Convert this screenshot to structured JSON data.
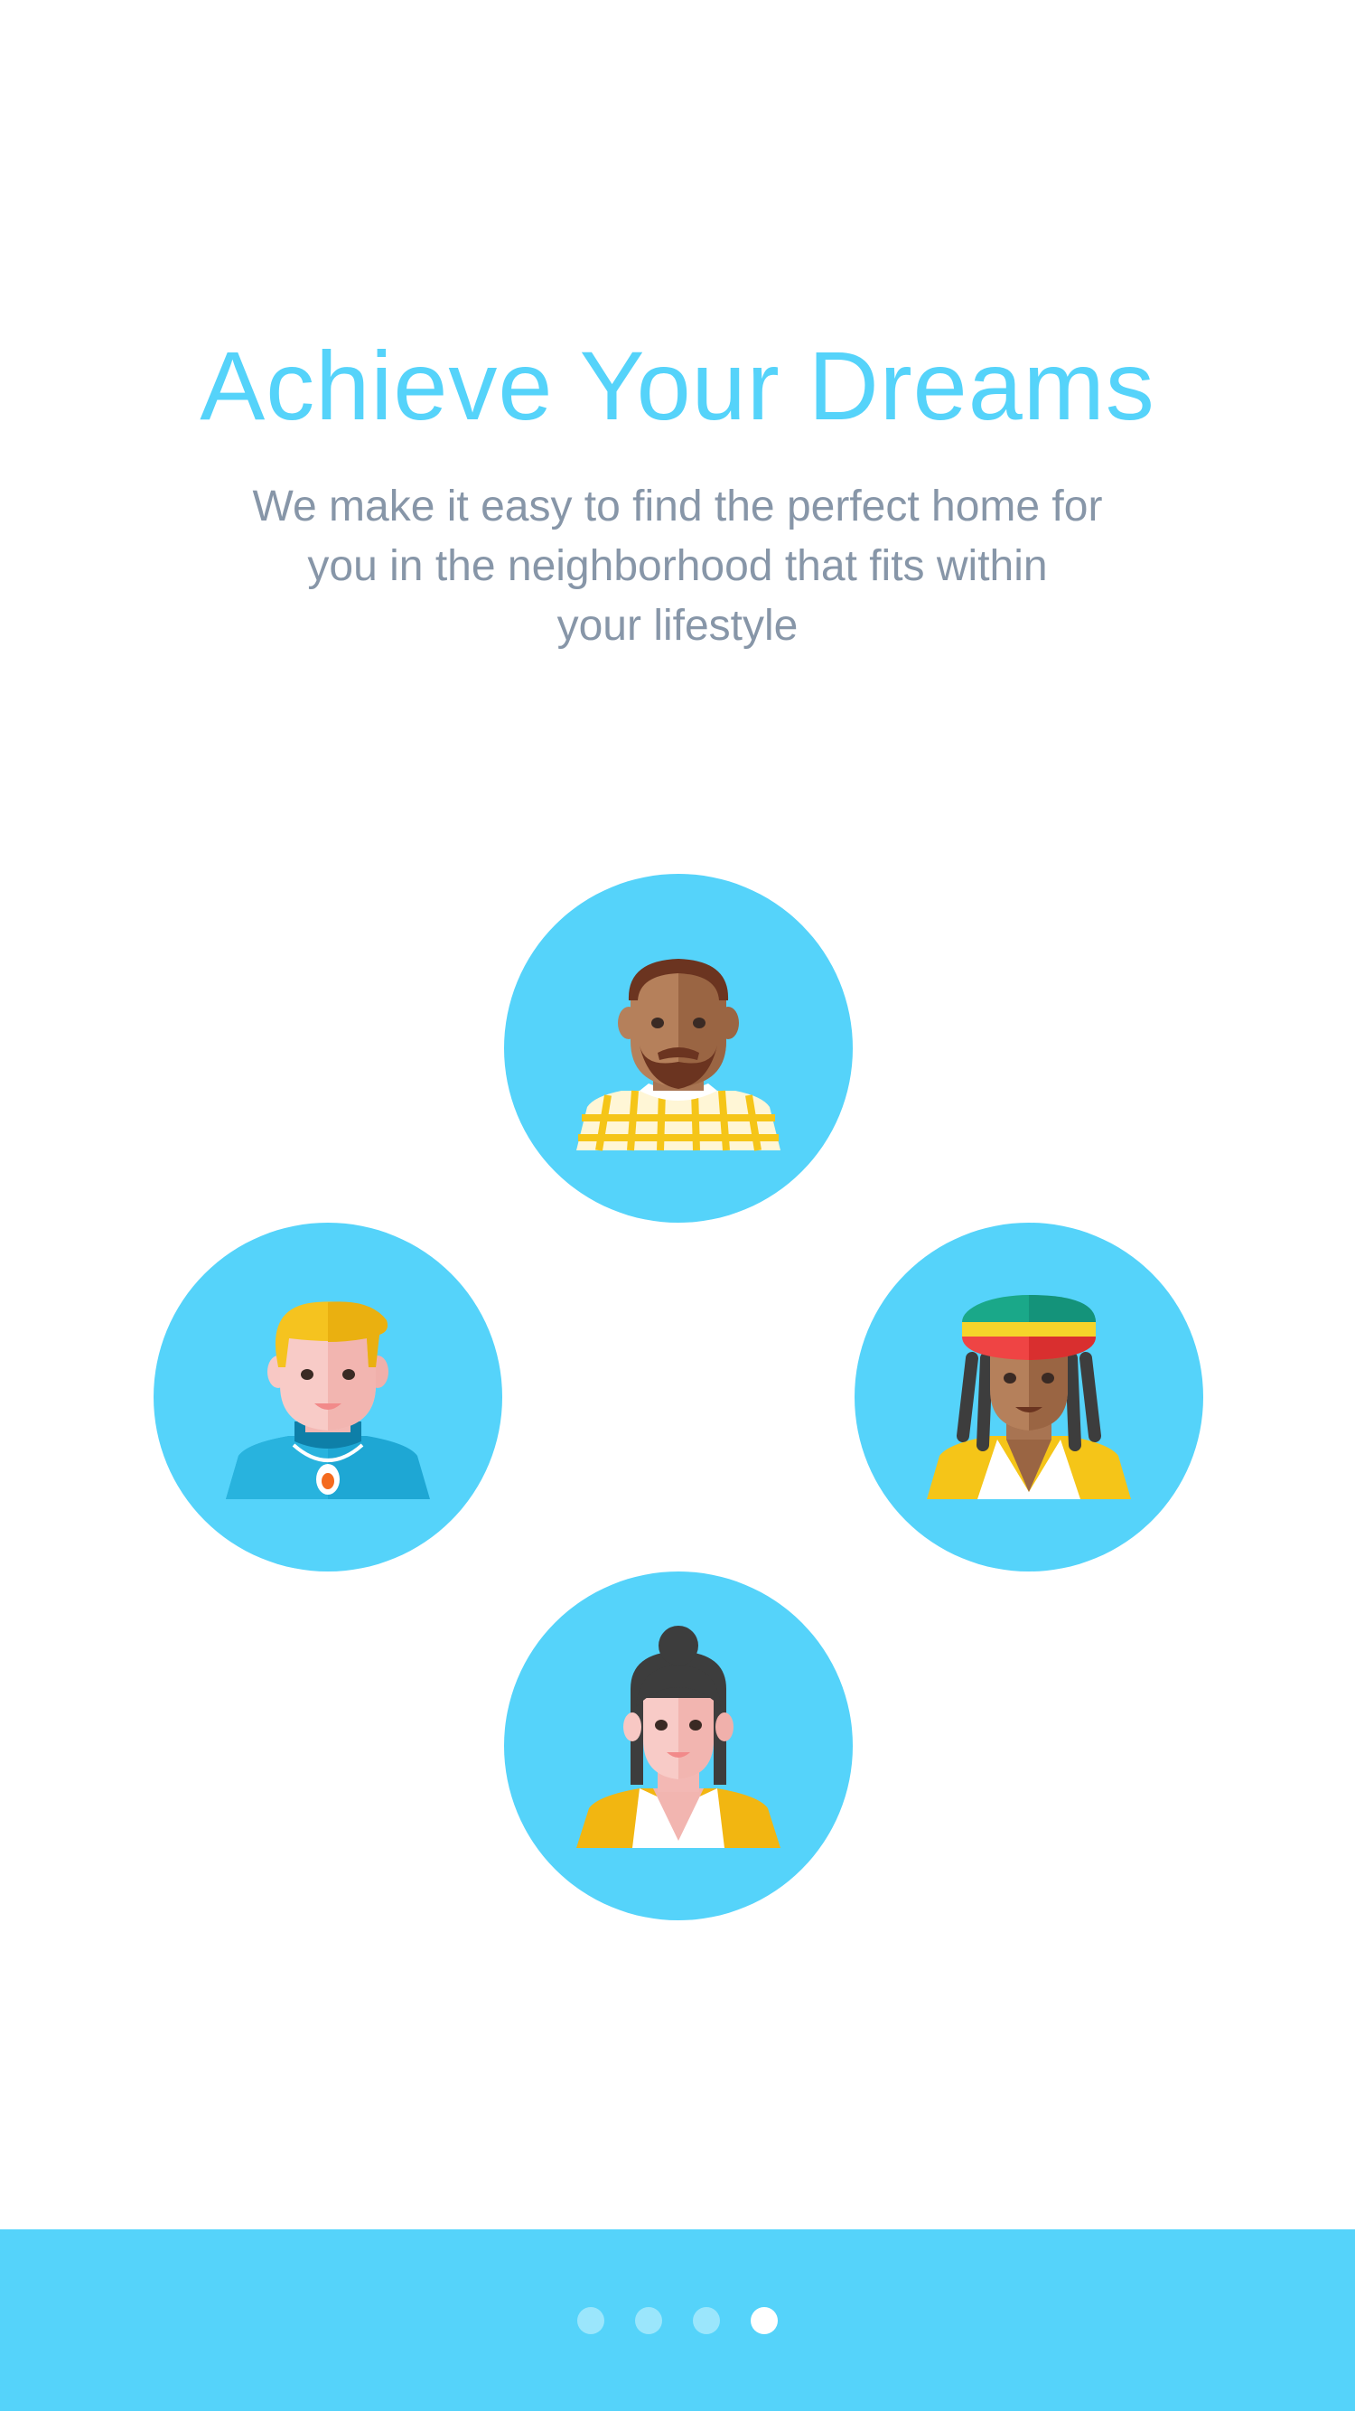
{
  "onboarding": {
    "title": "Achieve Your Dreams",
    "subtitle_line1": "We make it easy to find the perfect home for",
    "subtitle_line2": "you in the neighborhood that fits within",
    "subtitle_line3": "your lifestyle"
  },
  "avatars": [
    {
      "name": "bearded-man-avatar-icon"
    },
    {
      "name": "blond-man-avatar-icon"
    },
    {
      "name": "rasta-man-avatar-icon"
    },
    {
      "name": "woman-with-bun-avatar-icon"
    }
  ],
  "pager": {
    "page_count": 4,
    "active_page": 4
  },
  "colors": {
    "accent": "#55d3fa",
    "subtitle": "#8796a8",
    "background": "#ffffff",
    "dot_inactive": "#9be6fc",
    "dot_active": "#ffffff"
  }
}
